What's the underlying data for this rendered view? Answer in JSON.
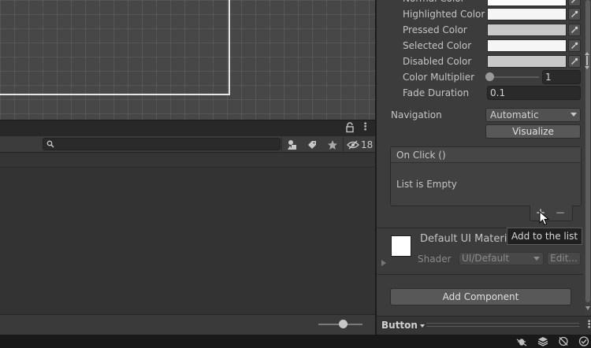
{
  "scene": {},
  "hierarchy": {
    "search": {
      "placeholder": "",
      "value": ""
    },
    "hidden_count": "18"
  },
  "inspector": {
    "properties": [
      {
        "label": "Normal Color",
        "color": "#ffffff"
      },
      {
        "label": "Highlighted Color",
        "color": "#f5f5f5"
      },
      {
        "label": "Pressed Color",
        "color": "#c8c8c8"
      },
      {
        "label": "Selected Color",
        "color": "#f5f5f5"
      },
      {
        "label": "Disabled Color",
        "color": "#c8c8c8"
      }
    ],
    "color_multiplier": {
      "label": "Color Multiplier",
      "value": "1",
      "slider_fraction": 0.0
    },
    "fade_duration": {
      "label": "Fade Duration",
      "value": "0.1"
    },
    "navigation": {
      "label": "Navigation",
      "value": "Automatic"
    },
    "visualize_label": "Visualize",
    "on_click": {
      "header": "On Click ()",
      "empty_text": "List is Empty"
    },
    "add_tooltip": "Add to the list",
    "material": {
      "name": "Default UI Materia",
      "shader_label": "Shader",
      "shader_value": "UI/Default",
      "edit_label": "Edit..."
    },
    "add_component_label": "Add Component",
    "footer": {
      "button_label": "Button"
    }
  },
  "icons": {
    "lock": "lock-icon",
    "search": "search-icon",
    "picker": "eyedropper-icon",
    "cursor": "mouse-cursor-icon"
  },
  "colors": {
    "scene_bg": "#474747",
    "inspector_bg": "#3c3c3c",
    "button_bg": "#585858",
    "tooltip_bg": "#202020"
  }
}
